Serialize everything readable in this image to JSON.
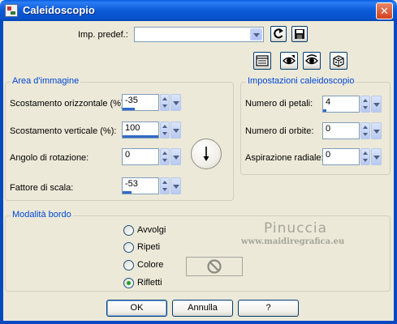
{
  "window": {
    "title": "Caleidoscopio",
    "close_symbol": "✕"
  },
  "presets": {
    "label": "Imp. predef.:",
    "value": "",
    "load_icon": "preset-reset-icon",
    "save_icon": "save-disk-icon"
  },
  "toolbar": {
    "icons": [
      "dialog-preview-icon",
      "proof-eye-icon",
      "auto-proof-eye-icon",
      "random-dice-icon"
    ]
  },
  "image_area": {
    "title": "Area d'immagine",
    "h_offset_label": "Scostamento orizzontale (%):",
    "h_offset_value": "-35",
    "h_offset_fill": 0.35,
    "v_offset_label": "Scostamento verticale (%):",
    "v_offset_value": "100",
    "v_offset_fill": 1.0,
    "rotation_label": "Angolo di rotazione:",
    "rotation_value": "0",
    "scale_label": "Fattore di scala:",
    "scale_value": "-53",
    "scale_fill": 0.25
  },
  "kaleidoscope": {
    "title": "Impostazioni caleidoscopio",
    "petals_label": "Numero di petali:",
    "petals_value": "4",
    "petals_fill": 0.08,
    "orbits_label": "Numero di orbite:",
    "orbits_value": "0",
    "suction_label": "Aspirazione radiale:",
    "suction_value": "0"
  },
  "edge_mode": {
    "title": "Modalità bordo",
    "options": [
      "Avvolgi",
      "Ripeti",
      "Colore",
      "Rifletti"
    ],
    "selected": "Rifletti"
  },
  "watermark": {
    "name": "Pinuccia",
    "url": "www.maidiregrafica.eu"
  },
  "buttons": {
    "ok": "OK",
    "cancel": "Annulla",
    "help": "?"
  },
  "colors": {
    "title_bar": "#0b5ad7",
    "dialog_bg": "#ece9d8",
    "group_title": "#0046d5",
    "spin_fill": "#3169c6",
    "radio_checked": "#21a121"
  }
}
